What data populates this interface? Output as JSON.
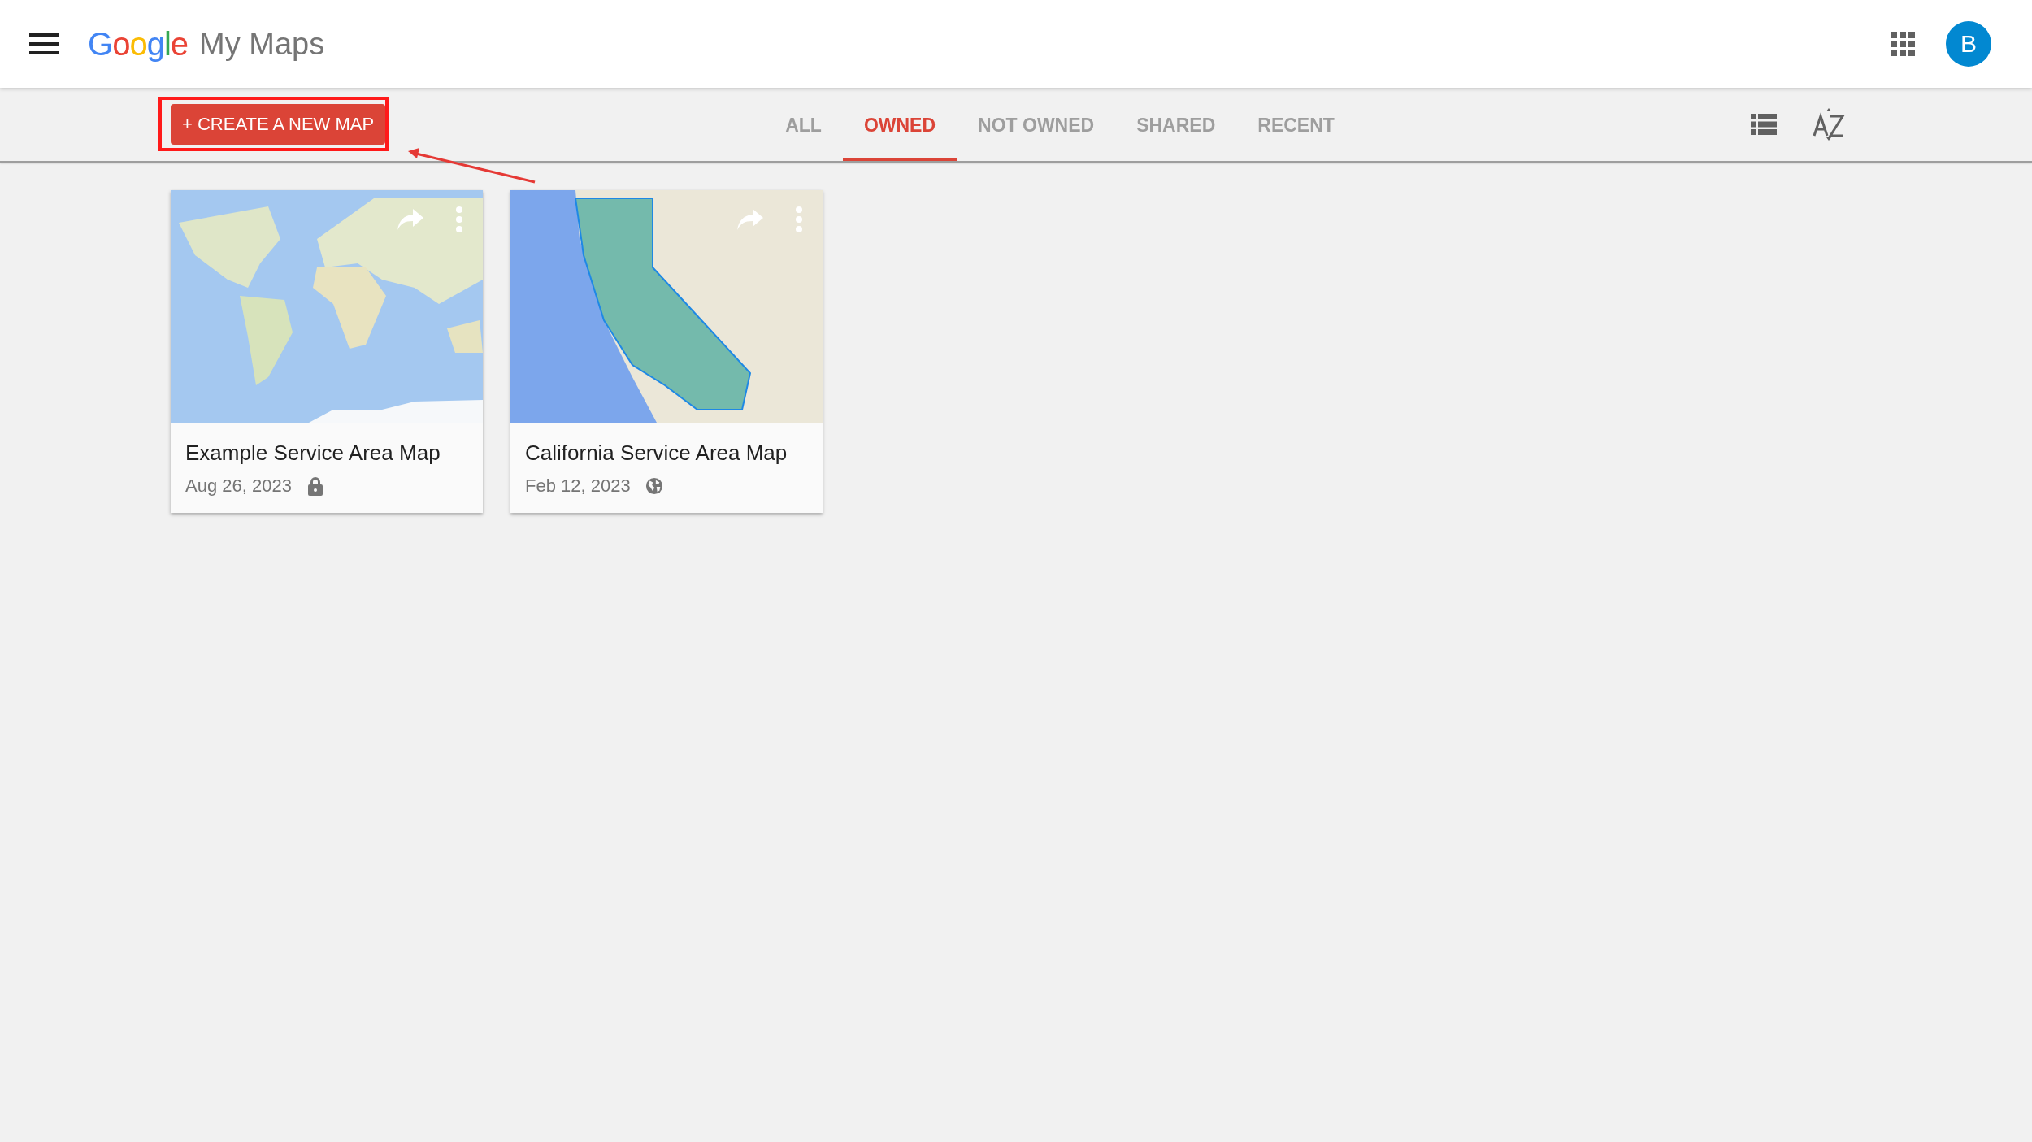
{
  "header": {
    "logo_word": "Google",
    "product": "My Maps",
    "avatar_letter": "B"
  },
  "toolbar": {
    "create_button": "+ CREATE A NEW MAP",
    "tabs": [
      {
        "label": "ALL",
        "selected": false
      },
      {
        "label": "OWNED",
        "selected": true
      },
      {
        "label": "NOT OWNED",
        "selected": false
      },
      {
        "label": "SHARED",
        "selected": false
      },
      {
        "label": "RECENT",
        "selected": false
      }
    ]
  },
  "maps": [
    {
      "title": "Example Service Area Map",
      "date": "Aug 26, 2023",
      "thumbnail": {
        "kind": "world"
      },
      "access_icon": {
        "kind": "lock"
      }
    },
    {
      "title": "California Service Area Map",
      "date": "Feb 12, 2023",
      "thumbnail": {
        "kind": "california"
      },
      "access_icon": {
        "kind": "globe"
      }
    }
  ]
}
